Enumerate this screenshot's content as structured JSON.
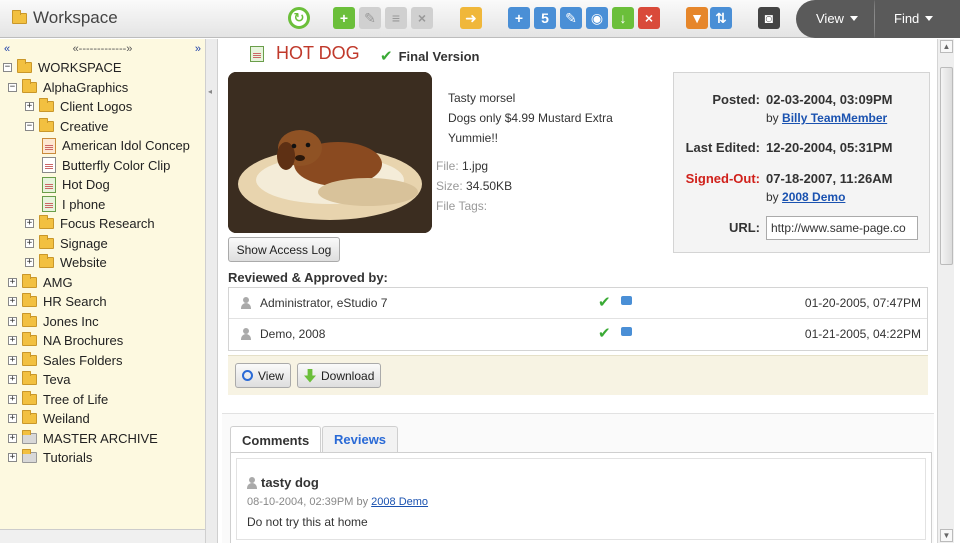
{
  "header": {
    "title": "Workspace",
    "view_label": "View",
    "find_label": "Find",
    "toolbar_icons": [
      "refresh-icon",
      "add-file-icon",
      "edit-file-icon",
      "properties-icon",
      "delete-file-icon",
      "move-icon",
      "add-icon",
      "add-five-icon",
      "edit-icon",
      "preview-icon",
      "download-icon",
      "delete-icon",
      "filter-icon",
      "sort-icon",
      "camera-icon"
    ]
  },
  "sidebar": {
    "collapse_left": "«",
    "mid_bar": "«-------------»",
    "collapse_right": "»",
    "tree": [
      {
        "label": "WORKSPACE",
        "depth": 0,
        "exp": "−",
        "icon": "folder"
      },
      {
        "label": "AlphaGraphics",
        "depth": 1,
        "exp": "−",
        "icon": "folder"
      },
      {
        "label": "Client Logos",
        "depth": 2,
        "exp": "+",
        "icon": "folder"
      },
      {
        "label": "Creative",
        "depth": 2,
        "exp": "−",
        "icon": "folder"
      },
      {
        "label": "American Idol Concep",
        "depth": 3,
        "exp": "",
        "icon": "doc-orange"
      },
      {
        "label": "Butterfly Color Clip",
        "depth": 3,
        "exp": "",
        "icon": "doc"
      },
      {
        "label": "Hot Dog",
        "depth": 3,
        "exp": "",
        "icon": "doc-green"
      },
      {
        "label": "I phone",
        "depth": 3,
        "exp": "",
        "icon": "doc-green"
      },
      {
        "label": "Focus Research",
        "depth": 2,
        "exp": "+",
        "icon": "folder"
      },
      {
        "label": "Signage",
        "depth": 2,
        "exp": "+",
        "icon": "folder"
      },
      {
        "label": "Website",
        "depth": 2,
        "exp": "+",
        "icon": "folder"
      },
      {
        "label": "AMG",
        "depth": 1,
        "exp": "+",
        "icon": "folder"
      },
      {
        "label": "HR Search",
        "depth": 1,
        "exp": "+",
        "icon": "folder"
      },
      {
        "label": "Jones Inc",
        "depth": 1,
        "exp": "+",
        "icon": "folder"
      },
      {
        "label": "NA Brochures",
        "depth": 1,
        "exp": "+",
        "icon": "folder"
      },
      {
        "label": "Sales Folders",
        "depth": 1,
        "exp": "+",
        "icon": "folder"
      },
      {
        "label": "Teva",
        "depth": 1,
        "exp": "+",
        "icon": "folder"
      },
      {
        "label": "Tree of Life",
        "depth": 1,
        "exp": "+",
        "icon": "folder"
      },
      {
        "label": "Weiland",
        "depth": 1,
        "exp": "+",
        "icon": "folder"
      },
      {
        "label": "MASTER ARCHIVE",
        "depth": 1,
        "exp": "+",
        "icon": "folder-gray"
      },
      {
        "label": "Tutorials",
        "depth": 1,
        "exp": "+",
        "icon": "folder-gray"
      }
    ]
  },
  "document": {
    "title": "HOT DOG",
    "status": "Final Version",
    "description_lines": [
      "Tasty morsel",
      "Dogs only $4.99 Mustard Extra",
      "Yummie!!"
    ],
    "file_label": "File:",
    "file_value": "1.jpg",
    "size_label": "Size:",
    "size_value": "34.50KB",
    "tags_label": "File Tags:",
    "show_access_log": "Show Access Log"
  },
  "posting": {
    "posted_label": "Posted:",
    "posted_value": "02-03-2004, 03:09PM",
    "posted_by_prefix": "by",
    "posted_by": "Billy TeamMember",
    "edited_label": "Last Edited:",
    "edited_value": "12-20-2004, 05:31PM",
    "signed_label": "Signed-Out:",
    "signed_value": "07-18-2007, 11:26AM",
    "signed_by_prefix": "by",
    "signed_by": "2008 Demo",
    "url_label": "URL:",
    "url_value": "http://www.same-page.co"
  },
  "reviews": {
    "heading": "Reviewed & Approved by:",
    "rows": [
      {
        "name": "Administrator, eStudio 7",
        "date": "01-20-2005, 07:47PM"
      },
      {
        "name": "Demo, 2008",
        "date": "01-21-2005, 04:22PM"
      }
    ]
  },
  "actions": {
    "view": "View",
    "download": "Download"
  },
  "tabs": {
    "comments": "Comments",
    "reviews": "Reviews"
  },
  "comment": {
    "title": "tasty dog",
    "date": "08-10-2004, 02:39PM",
    "by_prefix": "by",
    "author": "2008 Demo",
    "body": "Do not try this at home"
  },
  "colors": {
    "sidebar_bg": "#fdf9e0",
    "title_red": "#c0392b",
    "link_blue": "#1a52b0",
    "signed_out_red": "#d0201a",
    "approve_green": "#3aaa35"
  }
}
